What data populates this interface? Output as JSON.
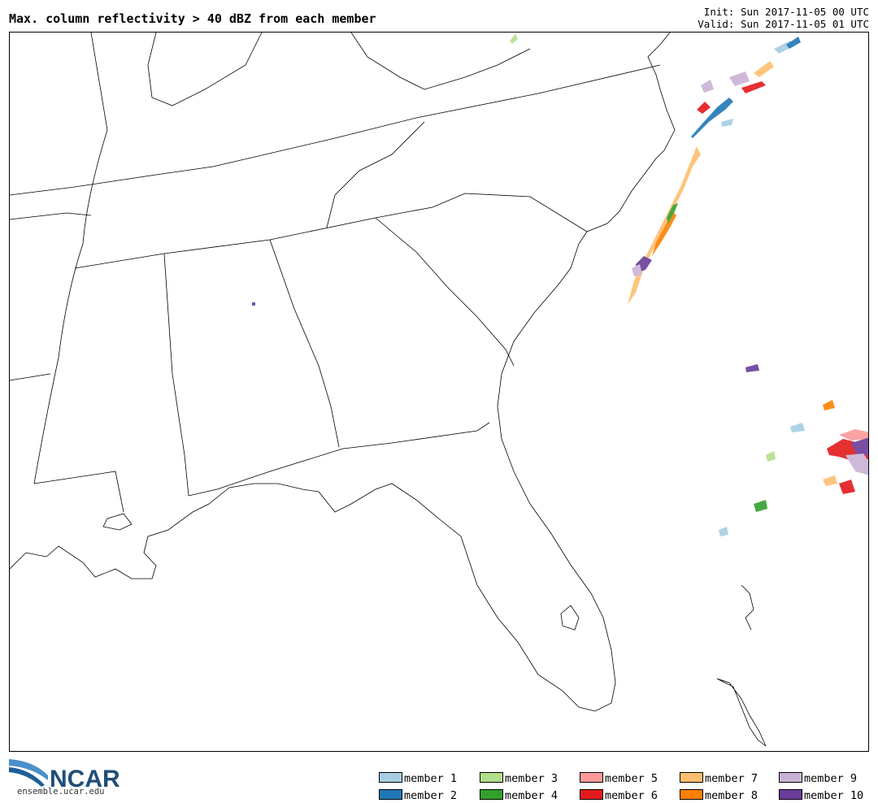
{
  "header": {
    "title": "Max. column reflectivity > 40 dBZ from each member",
    "init": "Init: Sun 2017-11-05 00 UTC",
    "valid": "Valid: Sun 2017-11-05 01 UTC"
  },
  "branding": {
    "logo_text": "NCAR",
    "url": "ensemble.ucar.edu"
  },
  "legend": {
    "members": [
      {
        "label": "member 1",
        "color": "#a6cee3"
      },
      {
        "label": "member 2",
        "color": "#1f78b4"
      },
      {
        "label": "member 3",
        "color": "#b2df8a"
      },
      {
        "label": "member 4",
        "color": "#33a02c"
      },
      {
        "label": "member 5",
        "color": "#fb9a99"
      },
      {
        "label": "member 6",
        "color": "#e31a1c"
      },
      {
        "label": "member 7",
        "color": "#fdbf6f"
      },
      {
        "label": "member 8",
        "color": "#ff7f00"
      },
      {
        "label": "member 9",
        "color": "#cab2d6"
      },
      {
        "label": "member 10",
        "color": "#6a3d9a"
      }
    ]
  }
}
